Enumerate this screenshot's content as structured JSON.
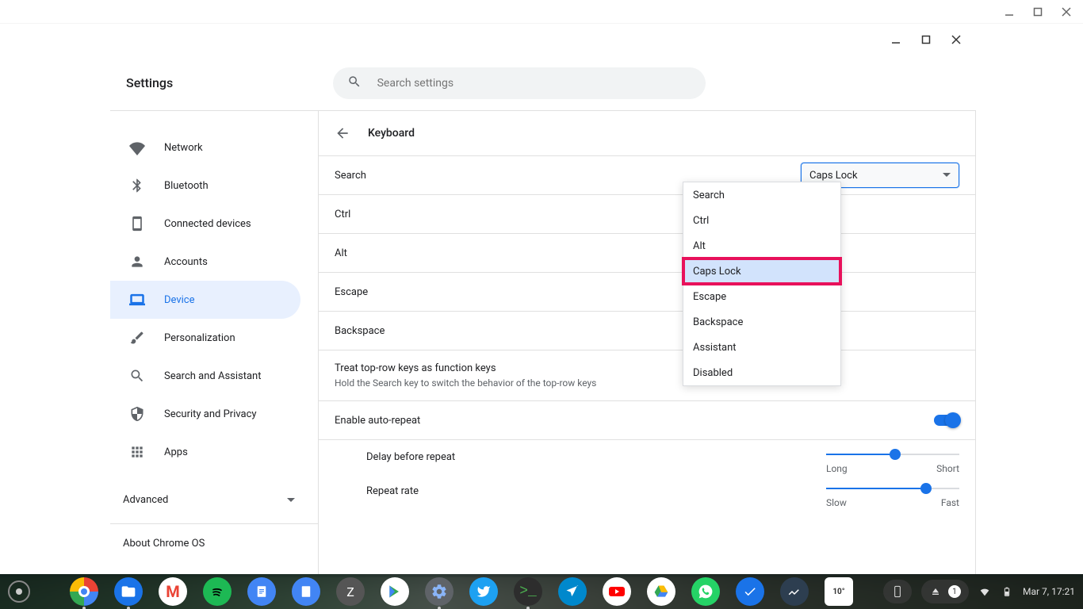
{
  "outer_window": {
    "minimize": "",
    "maximize": "",
    "close": ""
  },
  "inner_window": {
    "minimize": "",
    "maximize": "",
    "close": ""
  },
  "header": {
    "title": "Settings"
  },
  "search": {
    "placeholder": "Search settings"
  },
  "sidebar": {
    "items": [
      {
        "icon": "wifi",
        "label": "Network"
      },
      {
        "icon": "bluetooth",
        "label": "Bluetooth"
      },
      {
        "icon": "devices",
        "label": "Connected devices"
      },
      {
        "icon": "account",
        "label": "Accounts"
      },
      {
        "icon": "laptop",
        "label": "Device"
      },
      {
        "icon": "brush",
        "label": "Personalization"
      },
      {
        "icon": "search",
        "label": "Search and Assistant"
      },
      {
        "icon": "shield",
        "label": "Security and Privacy"
      },
      {
        "icon": "apps",
        "label": "Apps"
      }
    ],
    "advanced": "Advanced",
    "about": "About Chrome OS"
  },
  "page": {
    "title": "Keyboard",
    "rows": [
      {
        "label": "Search",
        "select": "Caps Lock"
      },
      {
        "label": "Ctrl"
      },
      {
        "label": "Alt"
      },
      {
        "label": "Escape"
      },
      {
        "label": "Backspace"
      }
    ],
    "function_keys": {
      "title": "Treat top-row keys as function keys",
      "sub": "Hold the Search key to switch the behavior of the top-row keys"
    },
    "auto_repeat": "Enable auto-repeat",
    "delay": {
      "label": "Delay before repeat",
      "left": "Long",
      "right": "Short",
      "value_pct": 52
    },
    "rate": {
      "label": "Repeat rate",
      "left": "Slow",
      "right": "Fast",
      "value_pct": 75
    }
  },
  "dropdown": {
    "options": [
      "Search",
      "Ctrl",
      "Alt",
      "Caps Lock",
      "Escape",
      "Backspace",
      "Assistant",
      "Disabled"
    ],
    "highlighted": "Caps Lock"
  },
  "taskbar": {
    "clock": "Mar 7, 17:21",
    "tray_badge": "1"
  }
}
